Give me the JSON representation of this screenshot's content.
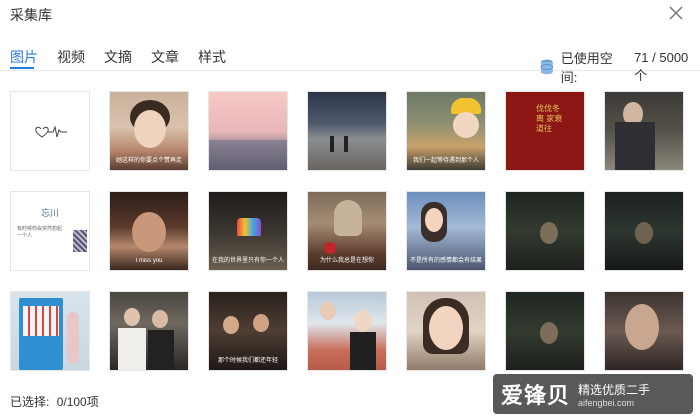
{
  "window": {
    "title": "采集库"
  },
  "tabs": [
    {
      "label": "图片",
      "active": true
    },
    {
      "label": "视频",
      "active": false
    },
    {
      "label": "文摘",
      "active": false
    },
    {
      "label": "文章",
      "active": false
    },
    {
      "label": "样式",
      "active": false
    }
  ],
  "storage": {
    "label": "已使用空间:",
    "value": "71 / 5000个"
  },
  "colors": {
    "accent": "#2c7be5"
  },
  "thumbnails": [
    {
      "caption": ""
    },
    {
      "caption": "她这样的你要点个赞再走"
    },
    {
      "caption": ""
    },
    {
      "caption": ""
    },
    {
      "caption": "我们一起等待遇到那个人"
    },
    {
      "caption": ""
    },
    {
      "caption": ""
    },
    {
      "caption": ""
    },
    {
      "caption": "I miss you"
    },
    {
      "caption": "在我的世界里只有你一个人"
    },
    {
      "caption": "为什么我总是在想你"
    },
    {
      "caption": "不是所有的感情都会有结果"
    },
    {
      "caption": ""
    },
    {
      "caption": ""
    },
    {
      "caption": ""
    },
    {
      "caption": ""
    },
    {
      "caption": "那个时候我们都还年轻"
    },
    {
      "caption": ""
    },
    {
      "caption": ""
    },
    {
      "caption": ""
    },
    {
      "caption": ""
    }
  ],
  "thumb_texts": {
    "t6_text": "伐伐冬离 家衰道往",
    "t8_title": "忘川",
    "t8_text": "有时候你会突然想起一个人"
  },
  "footer": {
    "label": "已选择:",
    "value": "0/100项"
  },
  "watermark": {
    "main": "爱锋贝",
    "top": "精选优质二手",
    "bottom": "aifengbei.com"
  }
}
